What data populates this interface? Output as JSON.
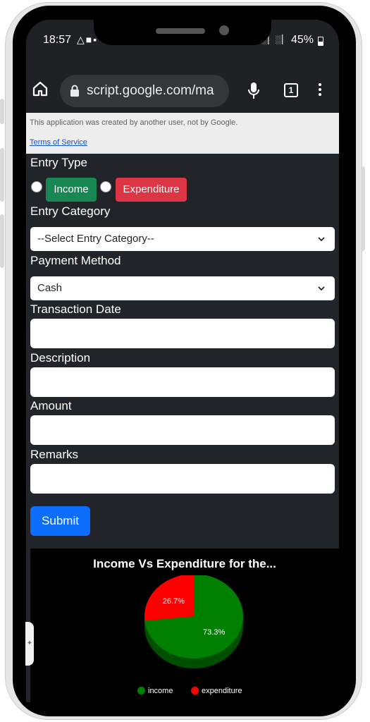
{
  "status_bar": {
    "time": "18:57",
    "left_icons": "△■▪",
    "battery_pct": "45%",
    "signal": "░▏░▏"
  },
  "browser": {
    "url": "script.google.com/ma",
    "tab_count": "1"
  },
  "banner": {
    "message": "This application was created by another user, not by Google.",
    "terms_link": "Terms of Service"
  },
  "form": {
    "entry_type_label": "Entry Type",
    "income_option": "Income",
    "expenditure_option": "Expenditure",
    "entry_category_label": "Entry Category",
    "entry_category_value": "--Select Entry Category--",
    "payment_method_label": "Payment Method",
    "payment_method_value": "Cash",
    "transaction_date_label": "Transaction Date",
    "description_label": "Description",
    "amount_label": "Amount",
    "remarks_label": "Remarks",
    "submit_label": "Submit"
  },
  "colors": {
    "income_badge": "#198754",
    "expenditure_badge": "#dc3545",
    "submit_button": "#0d6efd",
    "pie_income": "#008000",
    "pie_expenditure": "#ff0000"
  },
  "chart_data": {
    "type": "pie",
    "title": "Income Vs Expenditure for the...",
    "slices": [
      {
        "name": "income",
        "value": 73.3,
        "label": "73.3%",
        "color": "#008000"
      },
      {
        "name": "expenditure",
        "value": 26.7,
        "label": "26.7%",
        "color": "#ff0000"
      }
    ],
    "legend_position": "bottom"
  }
}
